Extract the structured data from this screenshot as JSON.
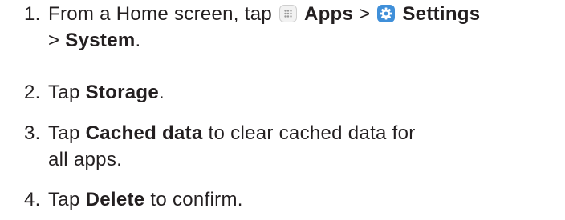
{
  "steps": [
    {
      "number": "1.",
      "text_before": "From a Home screen, tap ",
      "apps_icon": "apps-grid-icon",
      "apps_label": "Apps",
      "separator1": " > ",
      "settings_icon": "settings-gear-icon",
      "settings_label": "Settings",
      "separator2": "> ",
      "system_label": "System",
      "text_after": "."
    },
    {
      "number": "2.",
      "text_before": "Tap ",
      "bold": "Storage",
      "text_after": "."
    },
    {
      "number": "3.",
      "text_before": "Tap ",
      "bold": "Cached data",
      "text_after_line1": " to clear cached data for",
      "text_line2": "all apps."
    },
    {
      "number": "4.",
      "text_before": "Tap ",
      "bold": "Delete",
      "text_after": " to confirm."
    }
  ],
  "colors": {
    "text": "#231f20",
    "settings_icon_bg": "#3f8fd9"
  }
}
